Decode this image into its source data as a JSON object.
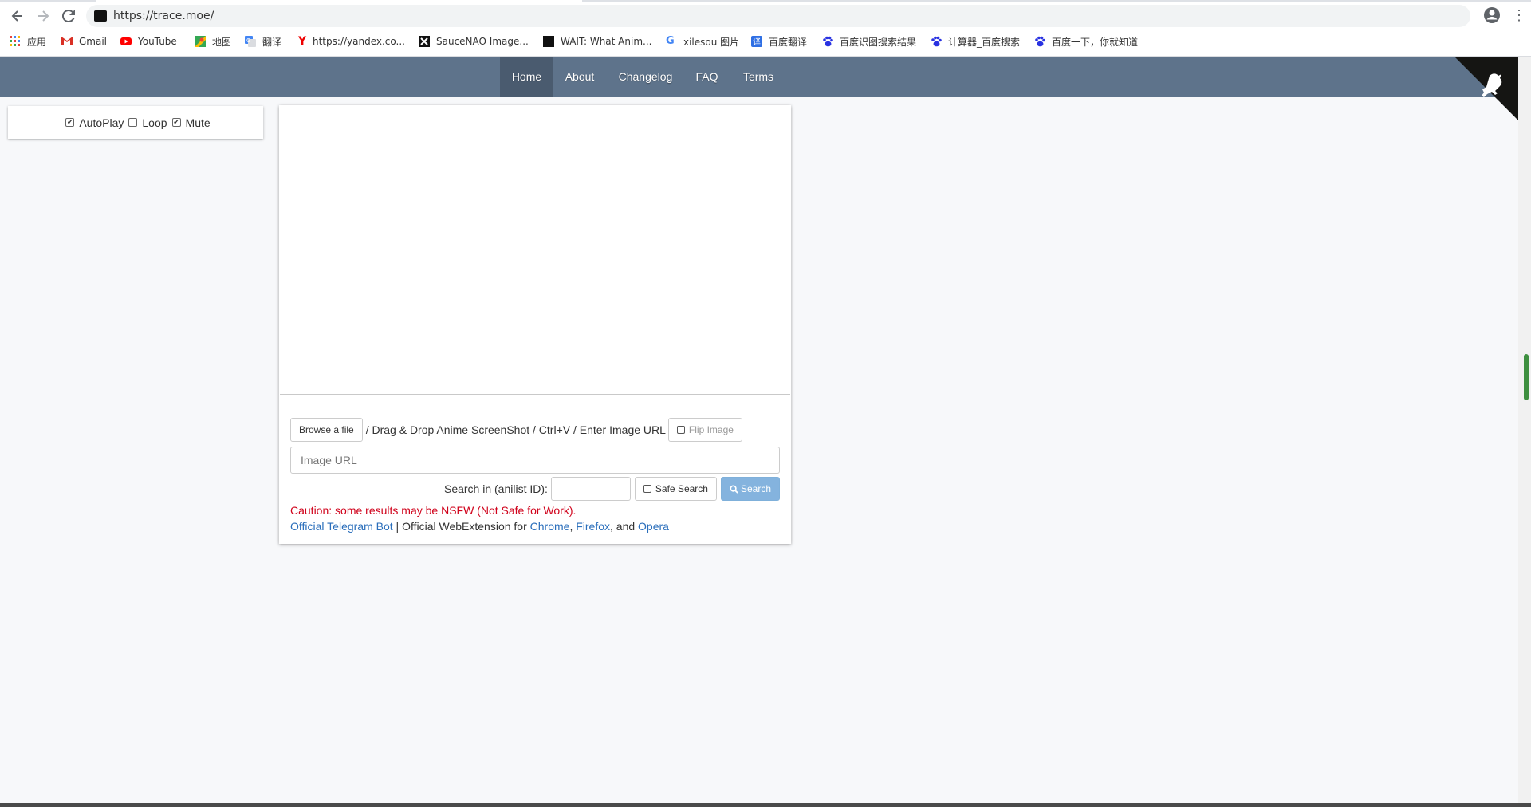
{
  "browser": {
    "url": "https://trace.moe/",
    "bookmarks": [
      {
        "label": "应用",
        "icon": "apps-grid-icon"
      },
      {
        "label": "Gmail",
        "icon": "gmail-icon"
      },
      {
        "label": "YouTube",
        "icon": "youtube-icon"
      },
      {
        "label": "地图",
        "icon": "maps-icon"
      },
      {
        "label": "翻译",
        "icon": "translate-icon"
      },
      {
        "label": "https://yandex.co...",
        "icon": "yandex-icon"
      },
      {
        "label": "SauceNAO Image...",
        "icon": "saucenao-icon"
      },
      {
        "label": "WAIT: What Anim...",
        "icon": "wait-icon"
      },
      {
        "label": "xilesou 图片",
        "icon": "google-icon"
      },
      {
        "label": "百度翻译",
        "icon": "baidu-fanyi-icon"
      },
      {
        "label": "百度识图搜索结果",
        "icon": "baidu-icon"
      },
      {
        "label": "计算器_百度搜索",
        "icon": "baidu-icon"
      },
      {
        "label": "百度一下，你就知道",
        "icon": "baidu-icon"
      }
    ]
  },
  "nav": {
    "items": [
      "Home",
      "About",
      "Changelog",
      "FAQ",
      "Terms"
    ],
    "active": "Home"
  },
  "player_options": {
    "autoplay": {
      "label": "AutoPlay",
      "checked": true
    },
    "loop": {
      "label": "Loop",
      "checked": false
    },
    "mute": {
      "label": "Mute",
      "checked": true
    }
  },
  "search": {
    "browse_label": "Browse a file",
    "instructions": "/ Drag & Drop Anime ScreenShot / Ctrl+V / Enter Image URL",
    "flip_label": "Flip Image",
    "url_placeholder": "Image URL",
    "anilist_label": "Search in (anilist ID):",
    "safe_search_label": "Safe Search",
    "search_label": "Search"
  },
  "caution": "Caution: some results may be NSFW (Not Safe for Work).",
  "links": {
    "telegram": "Official Telegram Bot",
    "separator": " | Official WebExtension for ",
    "chrome": "Chrome",
    "comma": ", ",
    "firefox": "Firefox",
    "and": ", and ",
    "opera": "Opera"
  },
  "colors": {
    "nav_bg": "#5e738b",
    "nav_active": "#4a5b6f",
    "caution": "#d0021b",
    "link": "#2a6ebb",
    "search_button": "#84b3de"
  }
}
